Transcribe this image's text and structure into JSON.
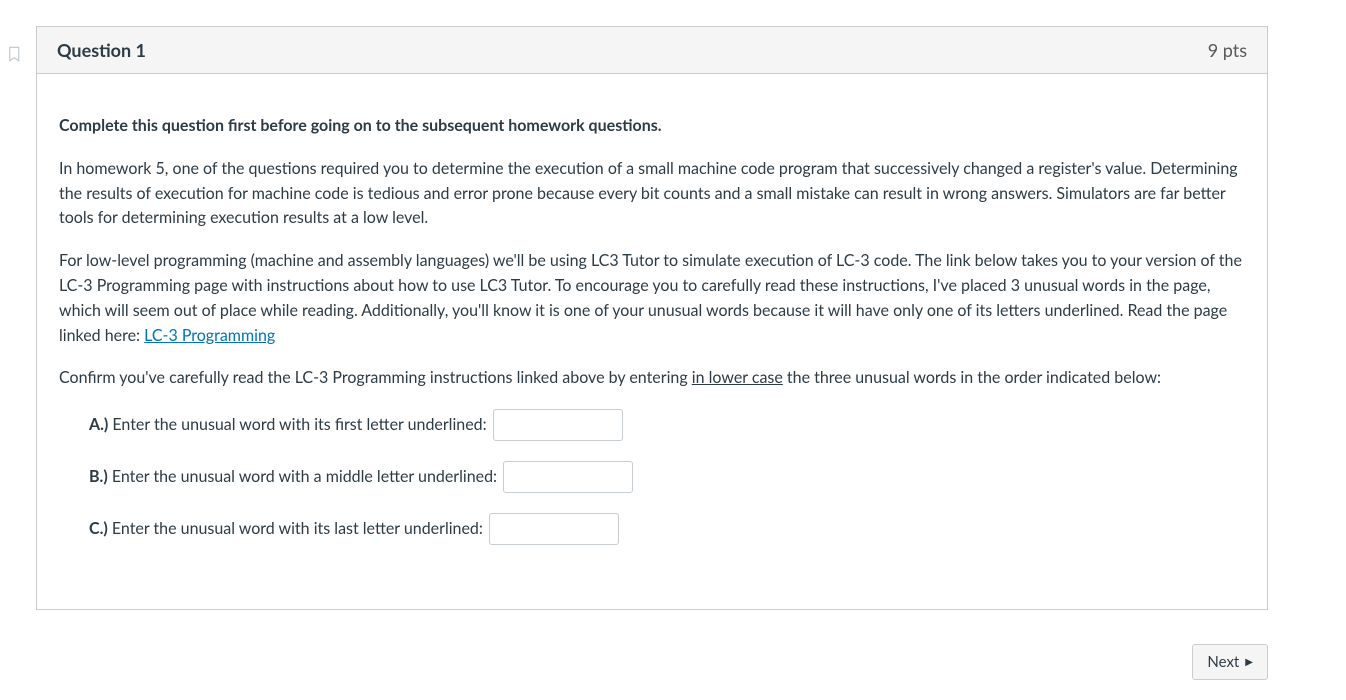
{
  "question": {
    "title": "Question 1",
    "points": "9 pts",
    "intro_bold": "Complete this question first before going on to the subsequent homework questions.",
    "para1": "In homework 5, one of the questions required you to determine the execution of a small machine code program that successively changed a register's value. Determining the results of execution for machine code is tedious and error prone because every bit counts and a small mistake can result in wrong answers. Simulators are far better tools for determining execution results at a low level.",
    "para2_pre": "For low-level programming (machine and assembly languages) we'll be using LC3 Tutor to simulate execution of LC-3 code. The link below takes you to your version of the LC-3 Programming page with instructions about how to use LC3 Tutor. To encourage you to carefully read these instructions, I've placed 3 unusual words in the page, which will seem out of place while reading. Additionally, you'll know it is one of your unusual words because it will have only one of its letters underlined. Read the page linked here: ",
    "link_text": "LC-3 Programming",
    "confirm_pre": "Confirm you've carefully read the LC-3 Programming instructions linked above by entering ",
    "confirm_underlined": "in lower case",
    "confirm_post": " the three unusual words in the order indicated below:",
    "answers": [
      {
        "label": "A.)",
        "text": " Enter the unusual word with its first letter underlined: "
      },
      {
        "label": "B.)",
        "text": " Enter the unusual word with a middle letter underlined: "
      },
      {
        "label": "C.)",
        "text": " Enter the unusual word with its last letter underlined: "
      }
    ]
  },
  "nav": {
    "next": "Next"
  }
}
